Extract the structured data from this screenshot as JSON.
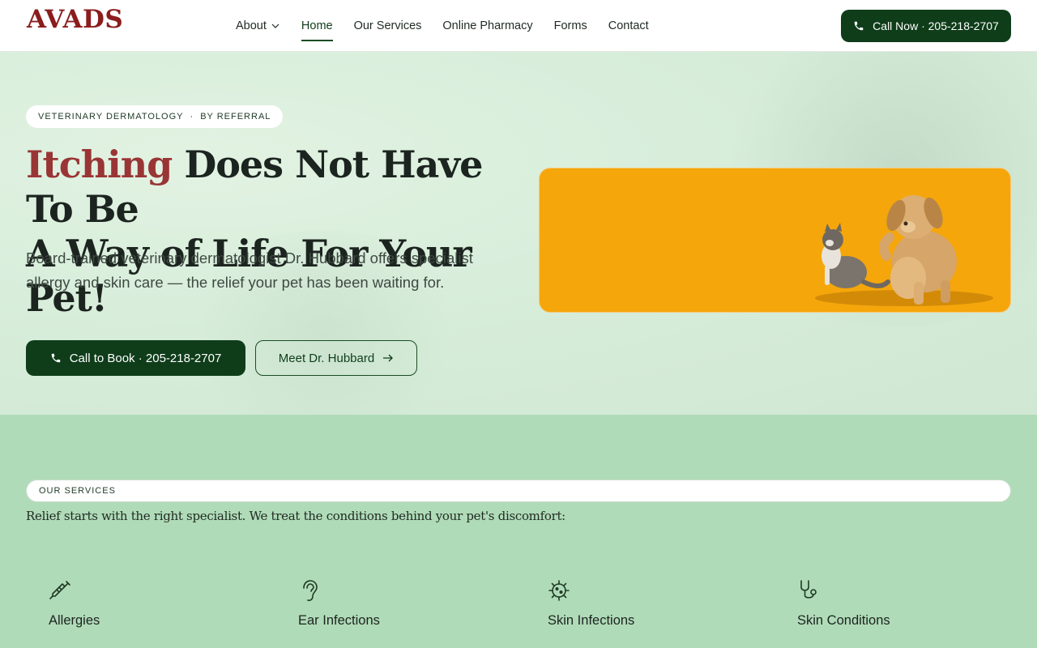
{
  "header": {
    "logo": "AVADS",
    "nav": [
      {
        "label": "About",
        "has_dropdown": true,
        "active": false
      },
      {
        "label": "Home",
        "active": true
      },
      {
        "label": "Our Services",
        "active": false
      },
      {
        "label": "Online Pharmacy",
        "active": false
      },
      {
        "label": "Forms",
        "active": false
      },
      {
        "label": "Contact",
        "active": false
      }
    ],
    "call_button": "Call Now · 205-218-2707"
  },
  "hero": {
    "tag": {
      "left": "VETERINARY DERMATOLOGY",
      "separator": "·",
      "right": "BY REFERRAL"
    },
    "headline_accent": "Itching",
    "headline_rest1": " Does Not Have To Be",
    "headline_rest2": "A Way of Life For Your Pet!",
    "subtext": "Board-trained veterinary dermatologist Dr. Hubbard offers specialist allergy and skin care — the relief your pet has been waiting for.",
    "primary_button": "Call to Book · 205-218-2707",
    "secondary_button": "Meet Dr. Hubbard",
    "image_bg": "#f5a60b"
  },
  "services": {
    "eyebrow": "OUR SERVICES",
    "intro": "Relief starts with the right specialist. We treat the conditions behind your pet's discomfort:",
    "items": [
      {
        "name": "Allergies",
        "icon": "syringe-icon"
      },
      {
        "name": "Ear Infections",
        "icon": "ear-icon"
      },
      {
        "name": "Skin Infections",
        "icon": "virus-icon"
      },
      {
        "name": "Skin Conditions",
        "icon": "stethoscope-icon"
      }
    ]
  },
  "colors": {
    "brand_red": "#8b1d1d",
    "accent_red": "#9a3535",
    "dark_green": "#0f3d1a",
    "services_bg": "#b0dbb8",
    "hero_bg": "#d8eedb"
  }
}
